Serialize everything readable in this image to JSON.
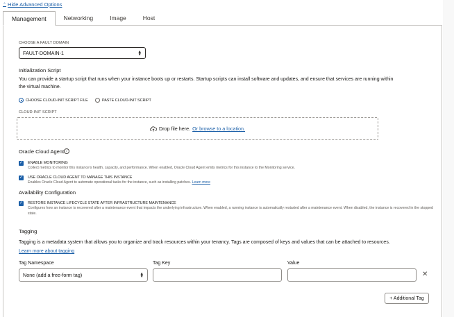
{
  "advanced": {
    "hide_label": "Hide Advanced Options"
  },
  "tabs": [
    {
      "label": "Management",
      "active": true
    },
    {
      "label": "Networking",
      "active": false
    },
    {
      "label": "Image",
      "active": false
    },
    {
      "label": "Host",
      "active": false
    }
  ],
  "fault_domain": {
    "label": "CHOOSE A FAULT DOMAIN",
    "value": "FAULT-DOMAIN-1"
  },
  "init_script": {
    "title": "Initialization Script",
    "description": "You can provide a startup script that runs when your instance boots up or restarts. Startup scripts can install software and updates, and ensure that services are running within the virtual machine.",
    "option_file": "CHOOSE CLOUD-INIT SCRIPT FILE",
    "option_paste": "PASTE CLOUD-INIT SCRIPT",
    "selected": "file",
    "script_label": "CLOUD-INIT SCRIPT",
    "drop_text": "Drop file here.",
    "browse_link": "Or browse to a location."
  },
  "cloud_agent": {
    "title": "Oracle Cloud Agent",
    "enable_monitoring": {
      "label": "ENABLE MONITORING",
      "checked": true,
      "description": "Collect metrics to monitor this instance's health, capacity, and performance. When enabled, Oracle Cloud Agent emits metrics for this instance to the Monitoring service."
    },
    "use_agent": {
      "label": "USE ORACLE CLOUD AGENT TO MANAGE THIS INSTANCE",
      "checked": true,
      "description": "Enables Oracle Cloud Agent to automate operational tasks for the instance, such as installing patches.",
      "learn_more": "Learn more"
    }
  },
  "availability": {
    "title": "Availability Configuration",
    "restore": {
      "label": "RESTORE INSTANCE LIFECYCLE STATE AFTER INFRASTRUCTURE MAINTENANCE",
      "checked": true,
      "description": "Configures how an instance is recovered after a maintenance event that impacts the underlying infrastructure. When enabled, a running instance is automatically restarted after a maintenance event. When disabled, the instance is recovered in the stopped state."
    }
  },
  "tagging": {
    "title": "Tagging",
    "description": "Tagging is a metadata system that allows you to organize and track resources within your tenancy. Tags are composed of keys and values that can be attached to resources.",
    "learn_more": "Learn more about tagging",
    "namespace_label": "Tag Namespace",
    "namespace_value": "None (add a free-form tag)",
    "key_label": "Tag Key",
    "key_value": "",
    "value_label": "Value",
    "value_value": "",
    "add_button": "+ Additional Tag"
  }
}
